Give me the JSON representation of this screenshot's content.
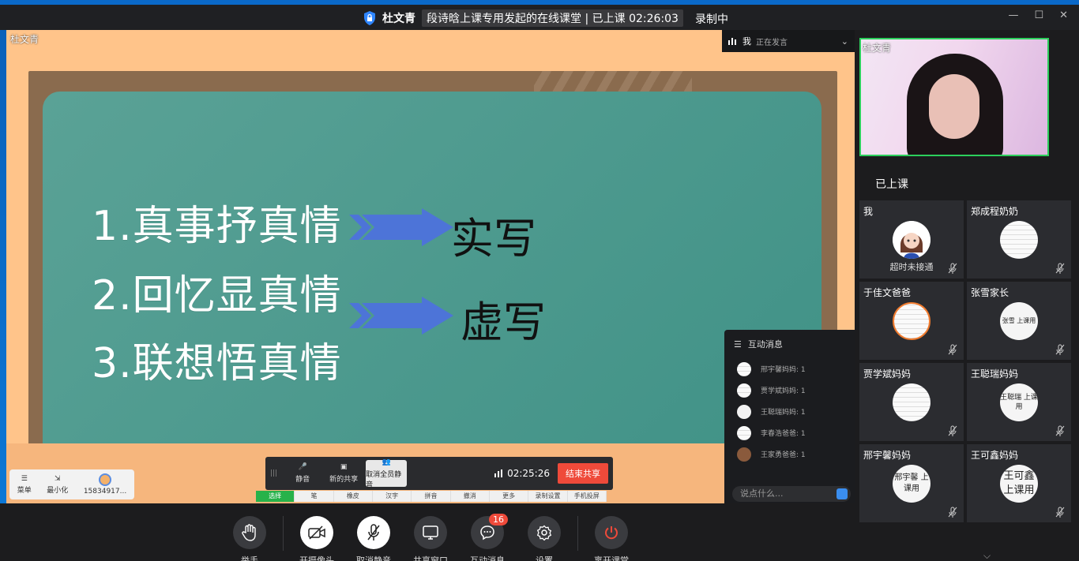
{
  "titlebar": {
    "teacher": "杜文青",
    "class_title": "段诗晗上课专用发起的在线课堂 | 已上课 02:26:03",
    "recording": "录制中",
    "win_min": "—",
    "win_max": "☐",
    "win_close": "✕"
  },
  "stage": {
    "presenter_name": "杜文青",
    "speaking_me": "我",
    "speaking_status": "正在发言",
    "lines": [
      "1.真事抒真情",
      "2.回忆显真情",
      "3.联想悟真情"
    ],
    "labels": [
      "实写",
      "虚写"
    ]
  },
  "mini_toolbar": {
    "menu": "菜单",
    "minimize": "最小化",
    "user": "15834917..."
  },
  "share_bar": {
    "mute": "静音",
    "new_share": "新的共享",
    "unmute_all": "取消全员静音",
    "time": "02:25:26",
    "end_share": "结束共享"
  },
  "pen_tools": [
    "选择",
    "笔",
    "橡皮",
    "汉字",
    "拼音",
    "撤消",
    "更多",
    "录制设置",
    "手机投屏"
  ],
  "chat": {
    "title": "互动消息",
    "messages": [
      {
        "text": "邢宇馨妈妈: 1"
      },
      {
        "text": "贾学斌妈妈: 1"
      },
      {
        "text": "王聪瑞妈妈: 1"
      },
      {
        "text": "李春浩爸爸: 1"
      },
      {
        "text": "王家勇爸爸: 1"
      }
    ],
    "placeholder": "说点什么..."
  },
  "video": {
    "name": "杜文青"
  },
  "participants_title": "已上课",
  "participants": [
    {
      "name": "我",
      "status": "超时未接通",
      "avatar": ""
    },
    {
      "name": "郑成程奶奶",
      "status": "",
      "avatar": ""
    },
    {
      "name": "于佳文爸爸",
      "status": "",
      "avatar": ""
    },
    {
      "name": "张雪家长",
      "status": "",
      "avatar": "张雪 上课用"
    },
    {
      "name": "贾学斌妈妈",
      "status": "",
      "avatar": ""
    },
    {
      "name": "王聪瑞妈妈",
      "status": "",
      "avatar": "王聪瑞 上课用"
    },
    {
      "name": "邢宇馨妈妈",
      "status": "",
      "avatar": "邢宇馨 上课用"
    },
    {
      "name": "王可鑫妈妈",
      "status": "",
      "avatar": "王可鑫 上课用"
    }
  ],
  "bottombar": {
    "raise_hand": "举手",
    "camera": "开摄像头",
    "unmute": "取消静音",
    "share": "共享窗口",
    "messages": "互动消息",
    "message_count": "16",
    "settings": "设置",
    "leave": "离开课堂"
  },
  "colors": {
    "accent_green": "#2ccf5c",
    "end_red": "#ef4a3a",
    "board": "#4a998d"
  }
}
